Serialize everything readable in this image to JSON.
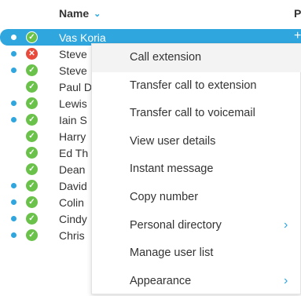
{
  "header": {
    "name_label": "Name",
    "sort_icon": "chevron-down-icon",
    "col2_label": "P"
  },
  "contacts": [
    {
      "name": "Vas Koria",
      "online": true,
      "status": "available",
      "selected": true,
      "action": "+"
    },
    {
      "name": "Steve",
      "online": true,
      "status": "busy"
    },
    {
      "name": "Steve",
      "online": true,
      "status": "available"
    },
    {
      "name": "Paul D",
      "online": false,
      "status": "available"
    },
    {
      "name": "Lewis",
      "online": true,
      "status": "available"
    },
    {
      "name": "Iain S",
      "online": true,
      "status": "available"
    },
    {
      "name": "Harry",
      "online": false,
      "status": "available"
    },
    {
      "name": "Ed Th",
      "online": false,
      "status": "available"
    },
    {
      "name": "Dean",
      "online": false,
      "status": "available"
    },
    {
      "name": "David",
      "online": true,
      "status": "available"
    },
    {
      "name": "Colin",
      "online": true,
      "status": "available"
    },
    {
      "name": "Cindy",
      "online": true,
      "status": "available"
    },
    {
      "name": "Chris",
      "online": true,
      "status": "available"
    }
  ],
  "context_menu": {
    "items": [
      {
        "label": "Call extension",
        "highlighted": true
      },
      {
        "label": "Transfer call to extension"
      },
      {
        "label": "Transfer call to voicemail"
      },
      {
        "label": "View user details"
      },
      {
        "label": "Instant message"
      },
      {
        "label": "Copy number"
      },
      {
        "label": "Personal directory",
        "submenu": true
      },
      {
        "label": "Manage user list"
      },
      {
        "label": "Appearance",
        "submenu": true
      }
    ]
  },
  "colors": {
    "accent": "#2fa6de",
    "available": "#6ac24a",
    "busy": "#e84a3c"
  }
}
